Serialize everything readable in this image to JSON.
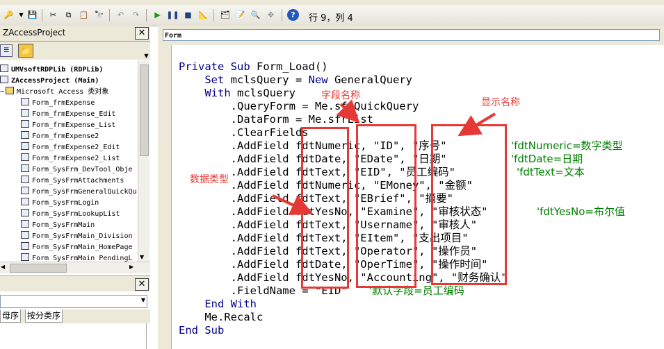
{
  "toolbar": {
    "status": "行 9，列 4"
  },
  "project": {
    "title": "ZAccessProject",
    "items": [
      "UMVsoftRDPLib (RDPLib)",
      "ZAccessProject (Main)",
      "Microsoft Access 类对象",
      "Form_frmExpense",
      "Form_frmExpense_Edit",
      "Form_frmExpense_List",
      "Form_frmExpense2",
      "Form_frmExpense2_Edit",
      "Form_frmExpense2_List",
      "Form_SysFrm_DevTool_Obje",
      "Form_SysFrmAttachments",
      "Form_SysFrmGeneralQuickQu",
      "Form_SysFrmLogin",
      "Form_SysFrmLookupList",
      "Form_SysFrmMain",
      "Form_SysFrmMain_Division",
      "Form_SysFrmMain_HomePage",
      "Form_SysFrmMain_PendingL"
    ]
  },
  "properties": {
    "tabs": [
      "母序",
      "按分类序"
    ]
  },
  "code": {
    "object": "Form",
    "lines": [
      "Private Sub Form_Load()",
      "    Set mclsQuery = New GeneralQuery",
      "    With mclsQuery",
      "        .QueryForm = Me.sfrQuickQuery",
      "        .DataForm = Me.sfrList",
      "        .ClearFields",
      "        .AddField fdtNumeric, \"ID\", \"序号\"",
      "        .AddField fdtDate, \"EDate\", \"日期\"",
      "        .AddField fdtText, \"EID\", \"员工编码\"",
      "        .AddField fdtNumeric, \"EMoney\", \"金额\"",
      "        .AddField fdtText, \"EBrief\", \"摘要\"",
      "        .AddField fdtYesNo, \"Examine\", \"审核状态\"",
      "        .AddField fdtText, \"Username\", \"审核人\"",
      "        .AddField fdtText, \"EItem\", \"支出项目\"",
      "        .AddField fdtText, \"Operator\", \"操作员\"",
      "        .AddField fdtDate, \"OperTime\", \"操作时间\"",
      "        .AddField fdtYesNo, \"Accounting\", \"财务确认\"",
      "        .FieldName = \"EID\"",
      "    End With",
      "    Me.Recalc",
      "End Sub"
    ],
    "comments": {
      "numeric": "'fdtNumeric=数字类型",
      "date": "'fdtDate=日期",
      "text": "'fdtText=文本",
      "yesno": "'fdtYesNo=布尔值",
      "default": "'默认字段=员工编码"
    }
  },
  "annotations": {
    "field_name": "字段名称",
    "display_name": "显示名称",
    "data_type": "数据类型"
  },
  "colors": {
    "keyword": "#00008b",
    "comment": "#008000",
    "annotation": "#e53935"
  }
}
